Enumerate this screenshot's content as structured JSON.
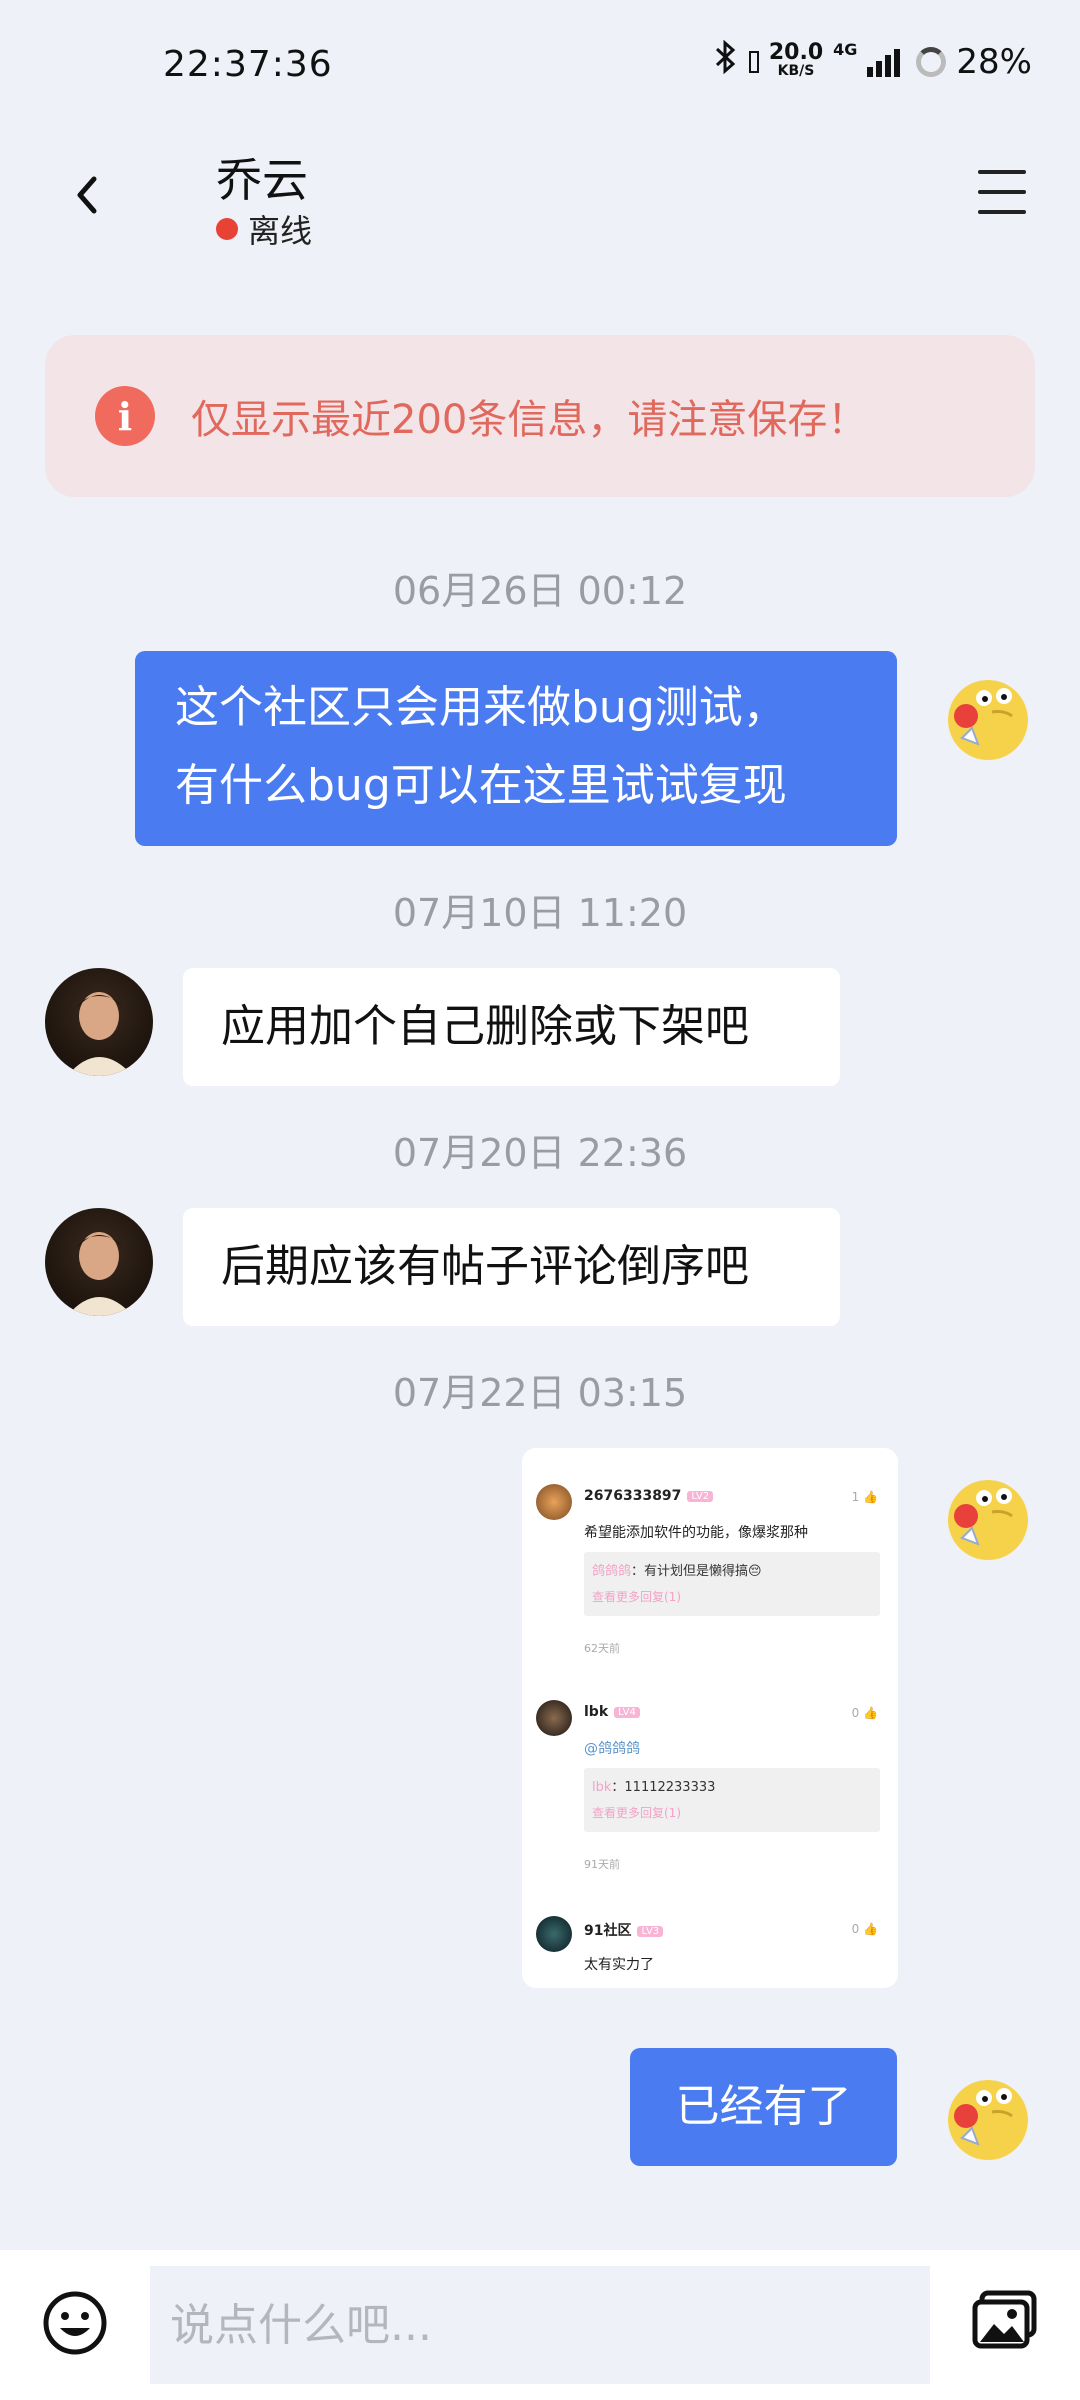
{
  "status_bar": {
    "time": "22:37:36",
    "net_speed_top": "20.0",
    "net_speed_bottom": "KB/S",
    "net_type": "4G",
    "battery": "28%"
  },
  "header": {
    "title": "乔云",
    "status": "离线",
    "status_color": "#e84235"
  },
  "notice": {
    "icon": "i",
    "text": "仅显示最近200条信息，请注意保存！"
  },
  "messages": {
    "ts1": "06月26日 00:12",
    "msg1_line1": "这个社区只会用来做bug测试，",
    "msg1_line2": "有什么bug可以在这里试试复现",
    "ts2": "07月10日 11:20",
    "msg2": "应用加个自己删除或下架吧",
    "ts3": "07月20日 22:36",
    "msg3": "后期应该有帖子评论倒序吧",
    "ts4": "07月22日 03:15",
    "msg5": "已经有了"
  },
  "image_card": {
    "c1_name": "2676333897",
    "c1_badge": "LV2",
    "c1_like": "1",
    "c1_text": "希望能添加软件的功能，像爆浆那种",
    "c1_reply_user": "鸽鸽鸽",
    "c1_reply_text": "：有计划但是懒得搞😔",
    "c1_more": "查看更多回复(1)",
    "c1_time": "62天前",
    "c2_name": "lbk",
    "c2_badge": "LV4",
    "c2_like": "0",
    "c2_text": "@鸽鸽鸽",
    "c2_reply_user": "lbk",
    "c2_reply_text": "：11112233333",
    "c2_more": "查看更多回复(1)",
    "c2_time": "91天前",
    "c3_name": "91社区",
    "c3_badge": "LV3",
    "c3_like": "0",
    "c3_text": "太有实力了"
  },
  "input": {
    "placeholder": "说点什么吧..."
  },
  "colors": {
    "outgoing_bubble": "#4a7bf1",
    "incoming_bubble": "#ffffff",
    "notice_bg": "#f3e4e7",
    "notice_text": "#e0685c"
  },
  "icons": {
    "back": "chevron-left-icon",
    "menu": "hamburger-menu-icon",
    "emoji": "smiley-face-icon",
    "image": "image-gallery-icon"
  }
}
